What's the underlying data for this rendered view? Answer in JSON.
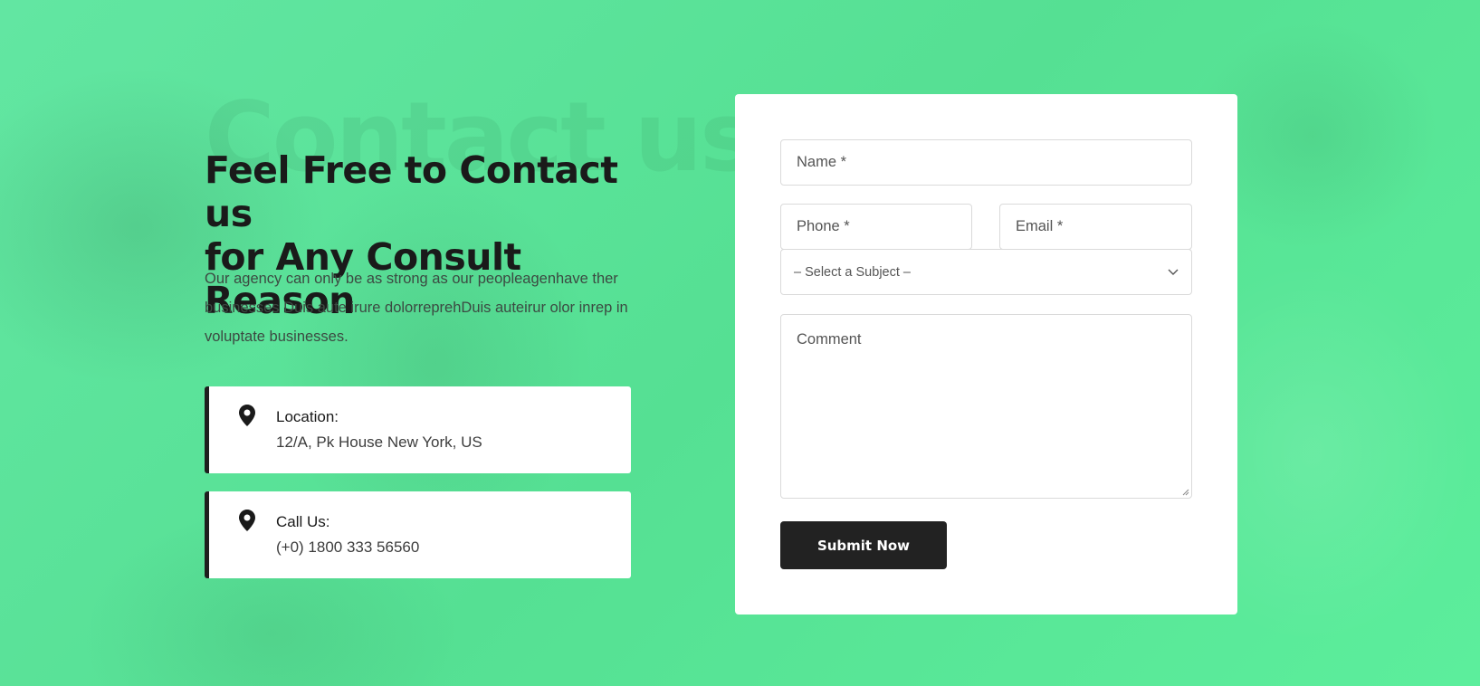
{
  "hero": {
    "watermark": "Contact us",
    "heading_line1": "Feel Free to Contact us",
    "heading_line2": "for Any Consult Reason",
    "description": "Our agency can only be as strong as our peopleagenhave ther businesses Duis aute irure dolorreprehDuis auteirur olor inrep in voluptate businesses."
  },
  "info": [
    {
      "icon": "location-pin-icon",
      "title": "Location:",
      "value": "12/A, Pk House New York, US"
    },
    {
      "icon": "location-pin-icon",
      "title": "Call Us:",
      "value": "(+0) 1800 333 56560"
    }
  ],
  "form": {
    "name_placeholder": "Name *",
    "phone_placeholder": "Phone *",
    "email_placeholder": "Email *",
    "subject_placeholder": "– Select a Subject –",
    "comment_placeholder": "Comment",
    "submit_label": "Submit Now"
  },
  "colors": {
    "background": "#5be49c",
    "text_dark": "#1a1a1a",
    "button": "#222222"
  }
}
